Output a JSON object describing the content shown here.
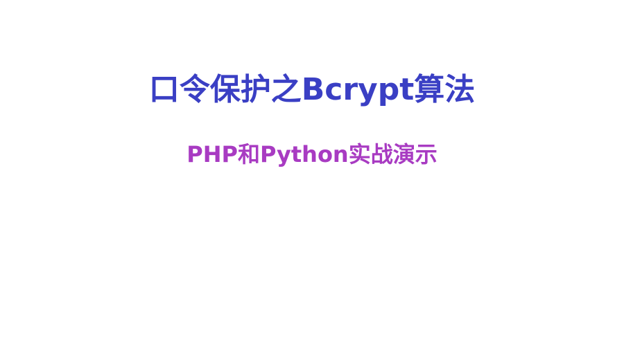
{
  "slide": {
    "title": "口令保护之Bcrypt算法",
    "subtitle": "PHP和Python实战演示"
  },
  "colors": {
    "background": "#ffffff",
    "title": "#3a3fc4",
    "subtitle": "#a83bc2"
  }
}
